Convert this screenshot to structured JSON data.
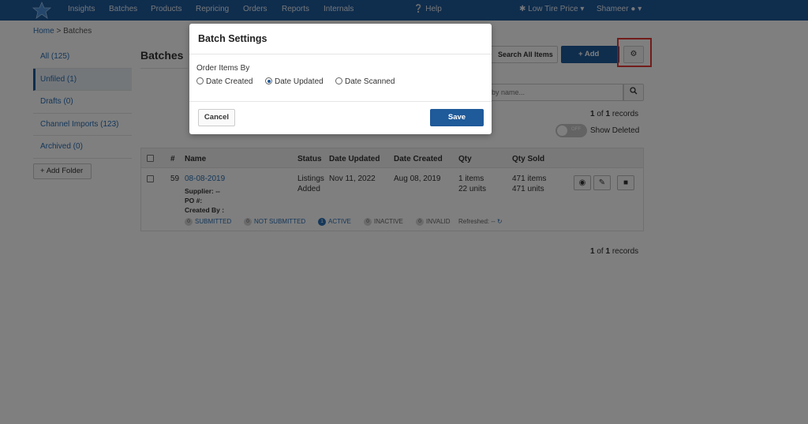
{
  "nav": {
    "items": [
      "Insights",
      "Batches",
      "Products",
      "Repricing",
      "Orders",
      "Reports",
      "Internals"
    ],
    "help": "Help",
    "store": "Low Tire Price",
    "user": "Shameer"
  },
  "breadcrumb": {
    "home": "Home",
    "separator": ">",
    "current": "Batches"
  },
  "sidebar": {
    "items": [
      {
        "label": "All (125)",
        "active": false
      },
      {
        "label": "Unfiled (1)",
        "active": true
      },
      {
        "label": "Drafts (0)",
        "active": false
      },
      {
        "label": "Channel Imports (123)",
        "active": false
      },
      {
        "label": "Archived (0)",
        "active": false
      }
    ],
    "add_folder": "Add Folder"
  },
  "main": {
    "title": "Batches",
    "search_all": "Search All Items",
    "add_batch": "Add Batch",
    "search_placeholder": "by name...",
    "records_top": {
      "from": "1",
      "of": "of",
      "total": "1",
      "suffix": "records"
    },
    "records_bottom": {
      "from": "1",
      "of": "of",
      "total": "1",
      "suffix": "records"
    },
    "toggle_label": "OFF",
    "show_deleted": "Show Deleted"
  },
  "table": {
    "headers": [
      "#",
      "Name",
      "Status",
      "Date Updated",
      "Date Created",
      "Qty",
      "Qty Sold"
    ],
    "rows": [
      {
        "id": "59",
        "name": "08-08-2019",
        "supplier": "Supplier: --",
        "po": "PO #:",
        "created_by": "Created By :",
        "status_line1": "Listings",
        "status_line2": "Added",
        "date_updated": "Nov 11, 2022",
        "date_created": "Aug 08, 2019",
        "qty_items": "1 items",
        "qty_units": "22 units",
        "sold_items": "471 items",
        "sold_units": "471 units",
        "stats": [
          {
            "count": "0",
            "label": "SUBMITTED"
          },
          {
            "count": "0",
            "label": "NOT SUBMITTED"
          },
          {
            "count": "1",
            "label": "ACTIVE"
          },
          {
            "count": "0",
            "label": "INACTIVE"
          },
          {
            "count": "0",
            "label": "INVALID"
          }
        ],
        "refreshed": "Refreshed: --"
      }
    ]
  },
  "modal": {
    "title": "Batch Settings",
    "order_label": "Order Items By",
    "options": [
      "Date Created",
      "Date Updated",
      "Date Scanned"
    ],
    "selected": "Date Updated",
    "cancel": "Cancel",
    "save": "Save"
  },
  "colors": {
    "nav": "#1f5a9a",
    "accent": "#1f5a9a",
    "link": "#2a6fb5",
    "highlight": "#e53935"
  }
}
